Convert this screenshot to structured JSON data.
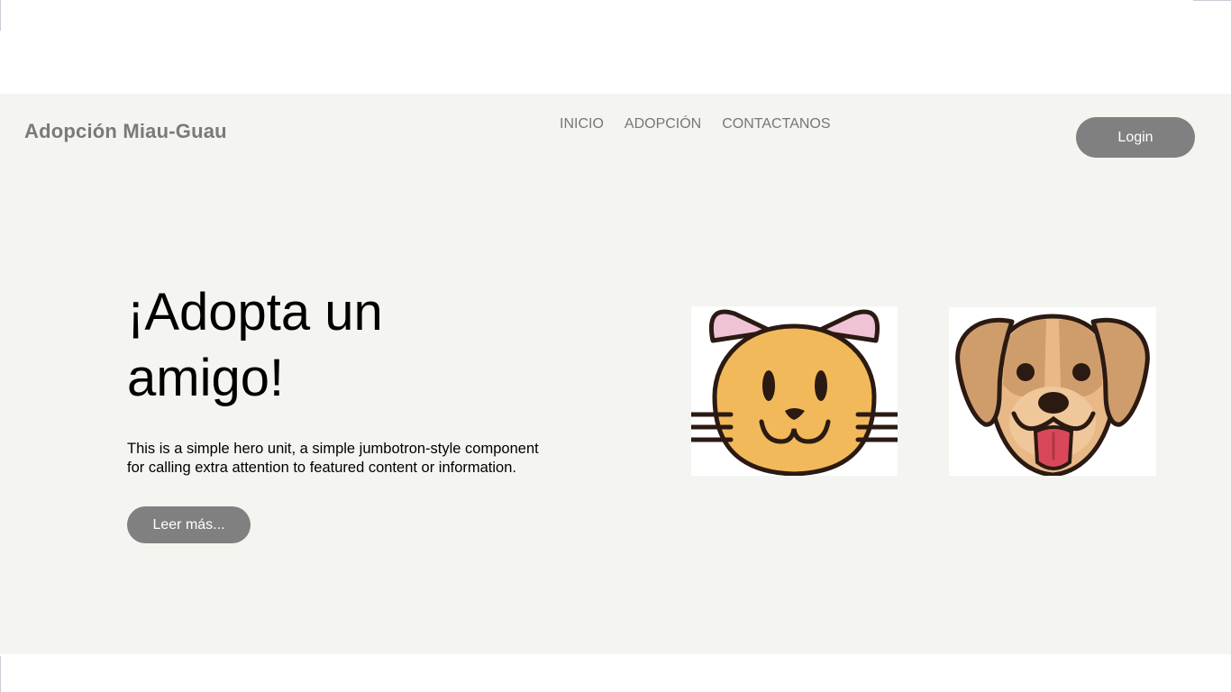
{
  "header": {
    "brand": "Adopción Miau-Guau",
    "nav": [
      {
        "label": "INICIO"
      },
      {
        "label": "ADOPCIÓN"
      },
      {
        "label": "CONTACTANOS"
      }
    ],
    "login_label": "Login"
  },
  "hero": {
    "title": "¡Adopta un amigo!",
    "description": "This is a simple hero unit, a simple jumbotron-style component for calling extra attention to featured content or information.",
    "more_label": "Leer más..."
  },
  "images": {
    "cat_icon": "cat-face-icon",
    "dog_icon": "dog-face-icon"
  },
  "colors": {
    "panel_background": "#f4f4f0",
    "button_background": "#808080",
    "brand_text": "#7a7a7a",
    "nav_text": "#777777"
  }
}
